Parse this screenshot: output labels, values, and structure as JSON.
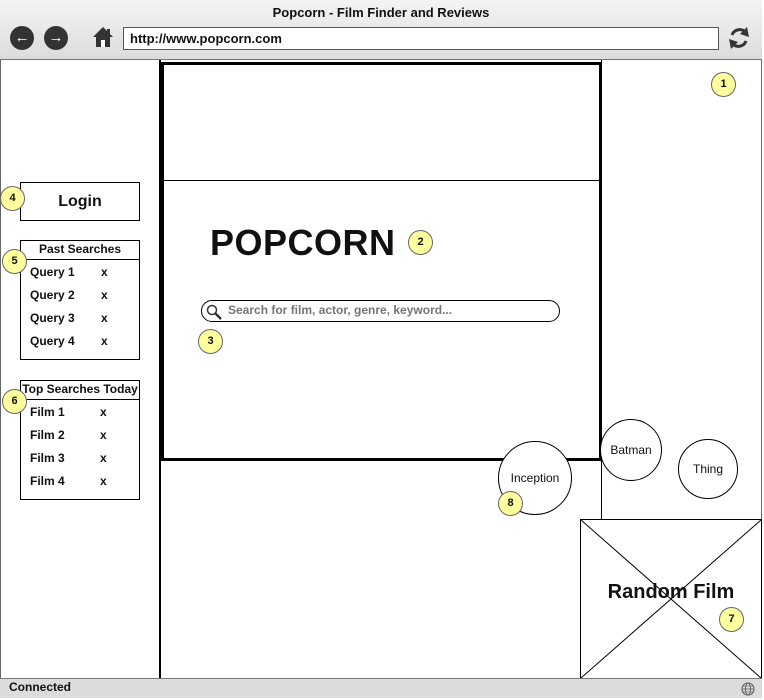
{
  "browser": {
    "title": "Popcorn - Film Finder and Reviews",
    "url": "http://www.popcorn.com",
    "status": "Connected"
  },
  "sidebar": {
    "login_label": "Login",
    "past_searches": {
      "title": "Past Searches",
      "items": [
        {
          "label": "Query 1",
          "remove": "x"
        },
        {
          "label": "Query 2",
          "remove": "x"
        },
        {
          "label": "Query 3",
          "remove": "x"
        },
        {
          "label": "Query 4",
          "remove": "x"
        }
      ]
    },
    "top_searches": {
      "title": "Top Searches Today",
      "items": [
        {
          "label": "Film 1",
          "remove": "x"
        },
        {
          "label": "Film 2",
          "remove": "x"
        },
        {
          "label": "Film 3",
          "remove": "x"
        },
        {
          "label": "Film 4",
          "remove": "x"
        }
      ]
    }
  },
  "main": {
    "heading": "POPCORN",
    "search_placeholder": "Search for film, actor, genre, keyword...",
    "suggestions": [
      "Inception",
      "Batman",
      "Thing"
    ],
    "random_label": "Random Film"
  },
  "callouts": [
    "1",
    "2",
    "3",
    "4",
    "5",
    "6",
    "7",
    "8"
  ]
}
